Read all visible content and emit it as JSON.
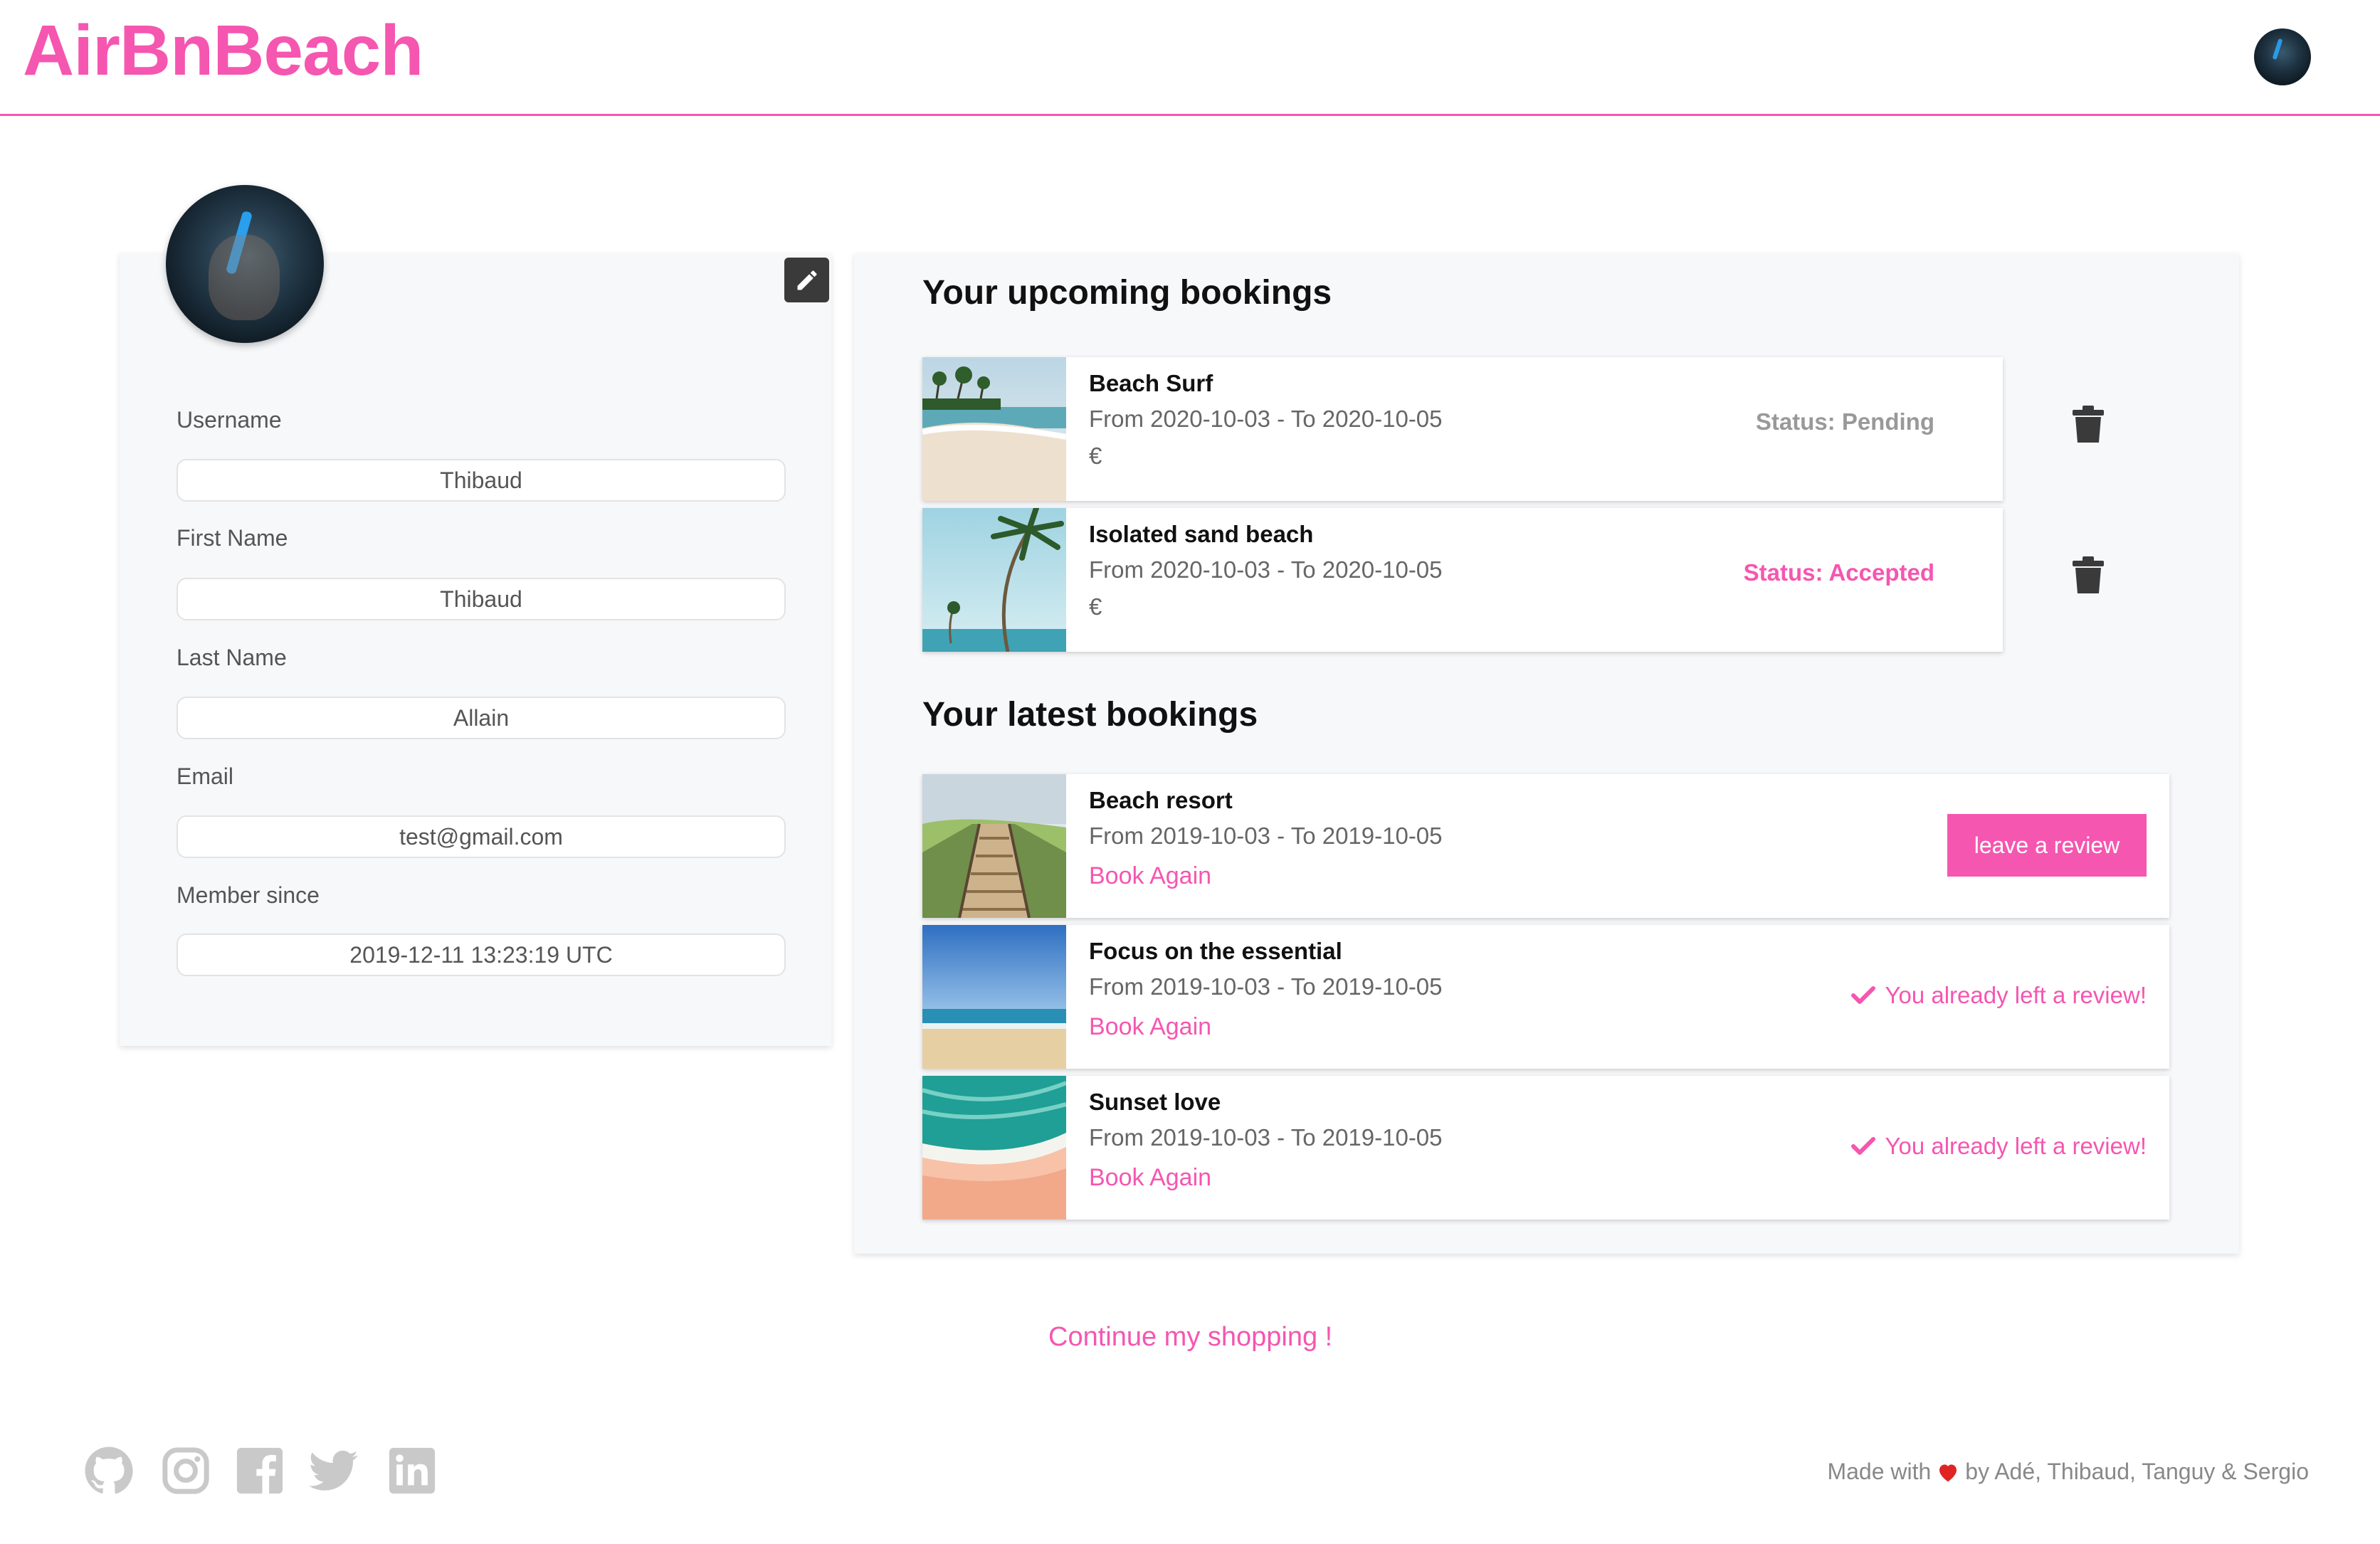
{
  "header": {
    "brand": "AirBnBeach",
    "user_avatar": "user-avatar"
  },
  "profile": {
    "edit_icon": "pencil-icon",
    "fields": [
      {
        "label": "Username",
        "value": "Thibaud"
      },
      {
        "label": "First Name",
        "value": "Thibaud"
      },
      {
        "label": "Last Name",
        "value": "Allain"
      },
      {
        "label": "Email",
        "value": "test@gmail.com"
      },
      {
        "label": "Member since",
        "value": "2019-12-11 13:23:19 UTC"
      }
    ]
  },
  "upcoming": {
    "title": "Your upcoming bookings",
    "items": [
      {
        "name": "Beach Surf",
        "dates": "From 2020-10-03 - To 2020-10-05",
        "price": "€",
        "status": "Status: Pending",
        "status_color": "#999999"
      },
      {
        "name": "Isolated sand beach",
        "dates": "From 2020-10-03 - To 2020-10-05",
        "price": "€",
        "status": "Status: Accepted",
        "status_color": "#f556b0"
      }
    ]
  },
  "latest": {
    "title": "Your latest bookings",
    "items": [
      {
        "name": "Beach resort",
        "dates": "From 2019-10-03 - To 2019-10-05",
        "again": "Book Again",
        "review_button": "leave a review"
      },
      {
        "name": "Focus on the essential",
        "dates": "From 2019-10-03 - To 2019-10-05",
        "again": "Book Again",
        "reviewed": "You already left a review!"
      },
      {
        "name": "Sunset love",
        "dates": "From 2019-10-03 - To 2019-10-05",
        "again": "Book Again",
        "reviewed": "You already left a review!"
      }
    ]
  },
  "continue_link": "Continue my shopping !",
  "footer": {
    "social_icons": [
      "github-icon",
      "instagram-icon",
      "facebook-icon",
      "twitter-icon",
      "linkedin-icon"
    ],
    "made_with": "Made with",
    "credits": "by Adé, Thibaud, Tanguy & Sergio"
  },
  "colors": {
    "accent": "#f556b0",
    "dark_icon": "#3a3a3a",
    "card_bg": "#f7f8fa"
  }
}
